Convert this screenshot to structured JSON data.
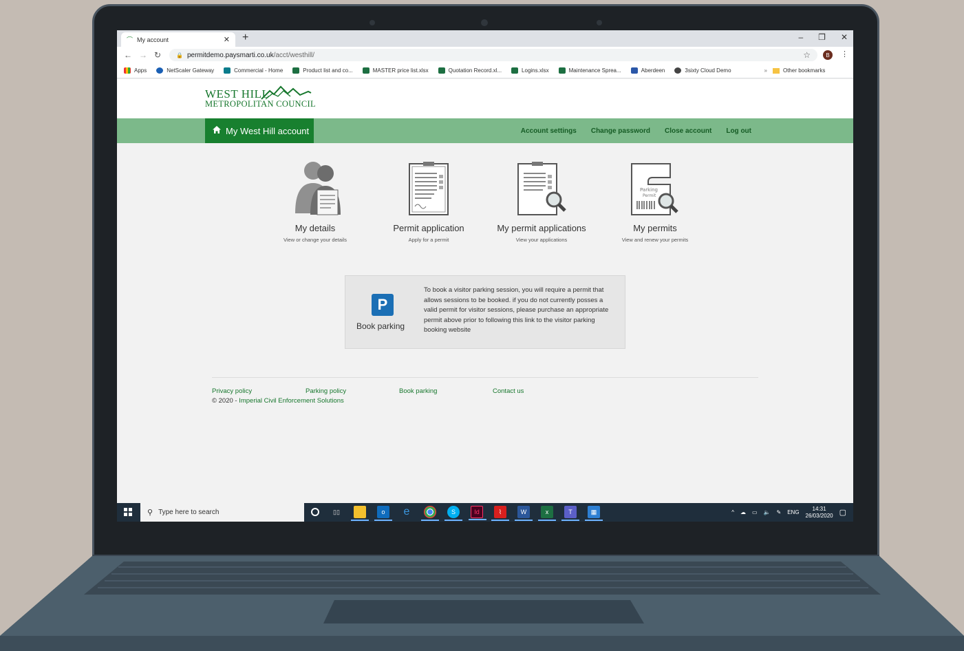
{
  "browser": {
    "tab_title": "My account",
    "new_tab_glyph": "+",
    "tab_close_glyph": "✕",
    "url_host": "permitdemo.paysmarti.co.uk",
    "url_path": "/acct/westhill/",
    "profile_initial": "B",
    "window_controls": [
      "–",
      "❐",
      "✕"
    ],
    "bookmarks": [
      {
        "label": "Apps",
        "icon": "apps-icon"
      },
      {
        "label": "NetScaler Gateway",
        "icon": "netscaler-icon"
      },
      {
        "label": "Commercial - Home",
        "icon": "sharepoint-icon"
      },
      {
        "label": "Product list and co...",
        "icon": "excel-icon"
      },
      {
        "label": "MASTER price list.xlsx",
        "icon": "excel-icon"
      },
      {
        "label": "Quotation Record.xl...",
        "icon": "excel-icon"
      },
      {
        "label": "Logins.xlsx",
        "icon": "excel-icon"
      },
      {
        "label": "Maintenance Sprea...",
        "icon": "excel-icon"
      },
      {
        "label": "Aberdeen",
        "icon": "aberdeen-icon"
      },
      {
        "label": "3sixty Cloud Demo",
        "icon": "cloud-icon"
      }
    ],
    "bookmarks_overflow": "»",
    "other_bookmarks": "Other bookmarks"
  },
  "site": {
    "logo_line1": "WEST HILL",
    "logo_line2": "METROPOLITAN COUNCIL",
    "brand_color": "#18802f",
    "nav_home": "My West Hill account",
    "nav_links": [
      "Account settings",
      "Change password",
      "Close account",
      "Log out"
    ],
    "tiles": [
      {
        "title": "My details",
        "subtitle": "View or change your details",
        "icon": "people-icon"
      },
      {
        "title": "Permit application",
        "subtitle": "Apply for a permit",
        "icon": "clipboard-icon"
      },
      {
        "title": "My permit applications",
        "subtitle": "View your applications",
        "icon": "clipboard-search-icon"
      },
      {
        "title": "My permits",
        "subtitle": "View and renew your permits",
        "icon": "parking-permit-icon"
      }
    ],
    "permit_icon_text_1": "Parking",
    "permit_icon_text_2": "Permit",
    "book_parking": {
      "badge": "P",
      "label": "Book parking",
      "text": "To book a visitor parking session, you will require a permit that allows sessions to be booked. if you do not currently posses a valid permit for visitor sessions, please purchase an appropriate permit above prior to following this link to the visitor parking booking website"
    },
    "footer_links": [
      "Privacy policy",
      "Parking policy",
      "Book parking",
      "Contact us"
    ],
    "copyright_prefix": "© 2020 - ",
    "copyright_owner": "Imperial Civil Enforcement Solutions"
  },
  "taskbar": {
    "search_placeholder": "Type here to search",
    "language": "ENG",
    "time": "14:31",
    "date": "26/03/2020"
  }
}
